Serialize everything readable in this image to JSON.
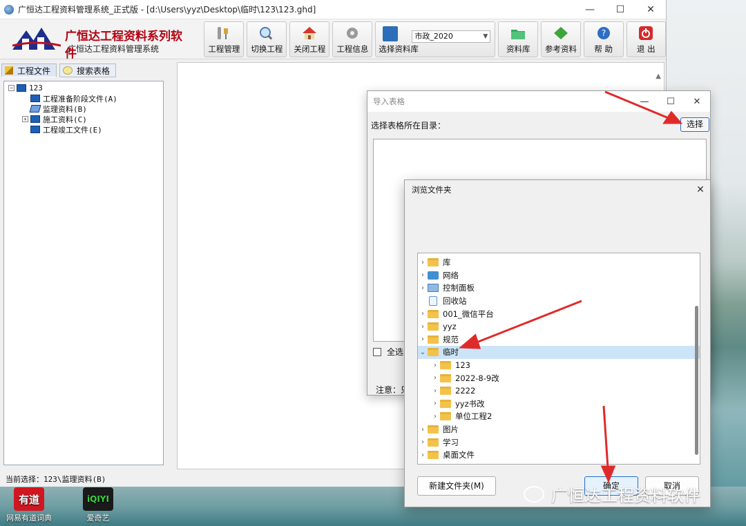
{
  "main_window": {
    "title": "广恒达工程资料管理系统_正式版 - [d:\\Users\\yyz\\Desktop\\临时\\123\\123.ghd]",
    "controls": [
      "—",
      "☐",
      "✕"
    ]
  },
  "logo": {
    "title": "广恒达工程资料系列软件",
    "subtitle": "广恒达工程资料管理系统"
  },
  "toolbar": {
    "project_mgmt": "工程管理",
    "switch_project": "切换工程",
    "close_project": "关闭工程",
    "project_info": "工程信息",
    "select_library": "选择资料库",
    "library_value": "市政_2020",
    "resource_lib": "资料库",
    "reference": "参考资料",
    "help": "帮 助",
    "exit": "退 出"
  },
  "left_tabs": {
    "project_files": "工程文件",
    "search_tables": "搜索表格"
  },
  "tree": {
    "root": "123",
    "items": [
      "工程准备阶段文件(A)",
      "监理资料(B)",
      "施工资料(C)",
      "工程竣工文件(E)"
    ]
  },
  "status_bar": "当前选择：123\\监理资料(B)",
  "import_dialog": {
    "title": "导入表格",
    "dir_label": "选择表格所在目录：",
    "choose_button": "选择",
    "select_all": "全选",
    "note": "注意：只"
  },
  "browse_dialog": {
    "title": "浏览文件夹",
    "folders": [
      {
        "label": "库",
        "icon": "folder-icon",
        "level": 0,
        "chevron": "›"
      },
      {
        "label": "网络",
        "icon": "network-icon",
        "level": 0,
        "chevron": "›"
      },
      {
        "label": "控制面板",
        "icon": "control-panel-icon",
        "level": 0,
        "chevron": "›"
      },
      {
        "label": "回收站",
        "icon": "recycle-bin-icon",
        "level": 0,
        "chevron": ""
      },
      {
        "label": "001_微信平台",
        "icon": "folder-icon",
        "level": 0,
        "chevron": "›"
      },
      {
        "label": "yyz",
        "icon": "folder-icon",
        "level": 0,
        "chevron": "›"
      },
      {
        "label": "规范",
        "icon": "folder-icon",
        "level": 0,
        "chevron": "›"
      },
      {
        "label": "临时",
        "icon": "folder-icon",
        "level": 0,
        "chevron": "⌄",
        "selected": true
      },
      {
        "label": "123",
        "icon": "folder-icon",
        "level": 1,
        "chevron": "›"
      },
      {
        "label": "2022-8-9改",
        "icon": "folder-icon",
        "level": 1,
        "chevron": "›"
      },
      {
        "label": "2222",
        "icon": "folder-icon",
        "level": 1,
        "chevron": "›"
      },
      {
        "label": "yyz书改",
        "icon": "folder-icon",
        "level": 1,
        "chevron": "›"
      },
      {
        "label": "单位工程2",
        "icon": "folder-icon",
        "level": 1,
        "chevron": "›"
      },
      {
        "label": "图片",
        "icon": "folder-icon",
        "level": 0,
        "chevron": "›"
      },
      {
        "label": "学习",
        "icon": "folder-icon",
        "level": 0,
        "chevron": "›"
      },
      {
        "label": "桌面文件",
        "icon": "folder-icon",
        "level": 0,
        "chevron": "›"
      }
    ],
    "new_folder": "新建文件夹(M)",
    "ok": "确定",
    "cancel": "取消"
  },
  "desktop": {
    "youdao_tile": "有道",
    "youdao_label": "网易有道词典",
    "iqiyi_tile": "iQIYI",
    "iqiyi_label": "爱奇艺"
  },
  "watermark": "广恒达工程资料软件",
  "colors": {
    "arrow": "#e02a2a",
    "brand_red": "#b30010",
    "accent_blue": "#1e6fd0",
    "selection": "#cce4f7"
  }
}
